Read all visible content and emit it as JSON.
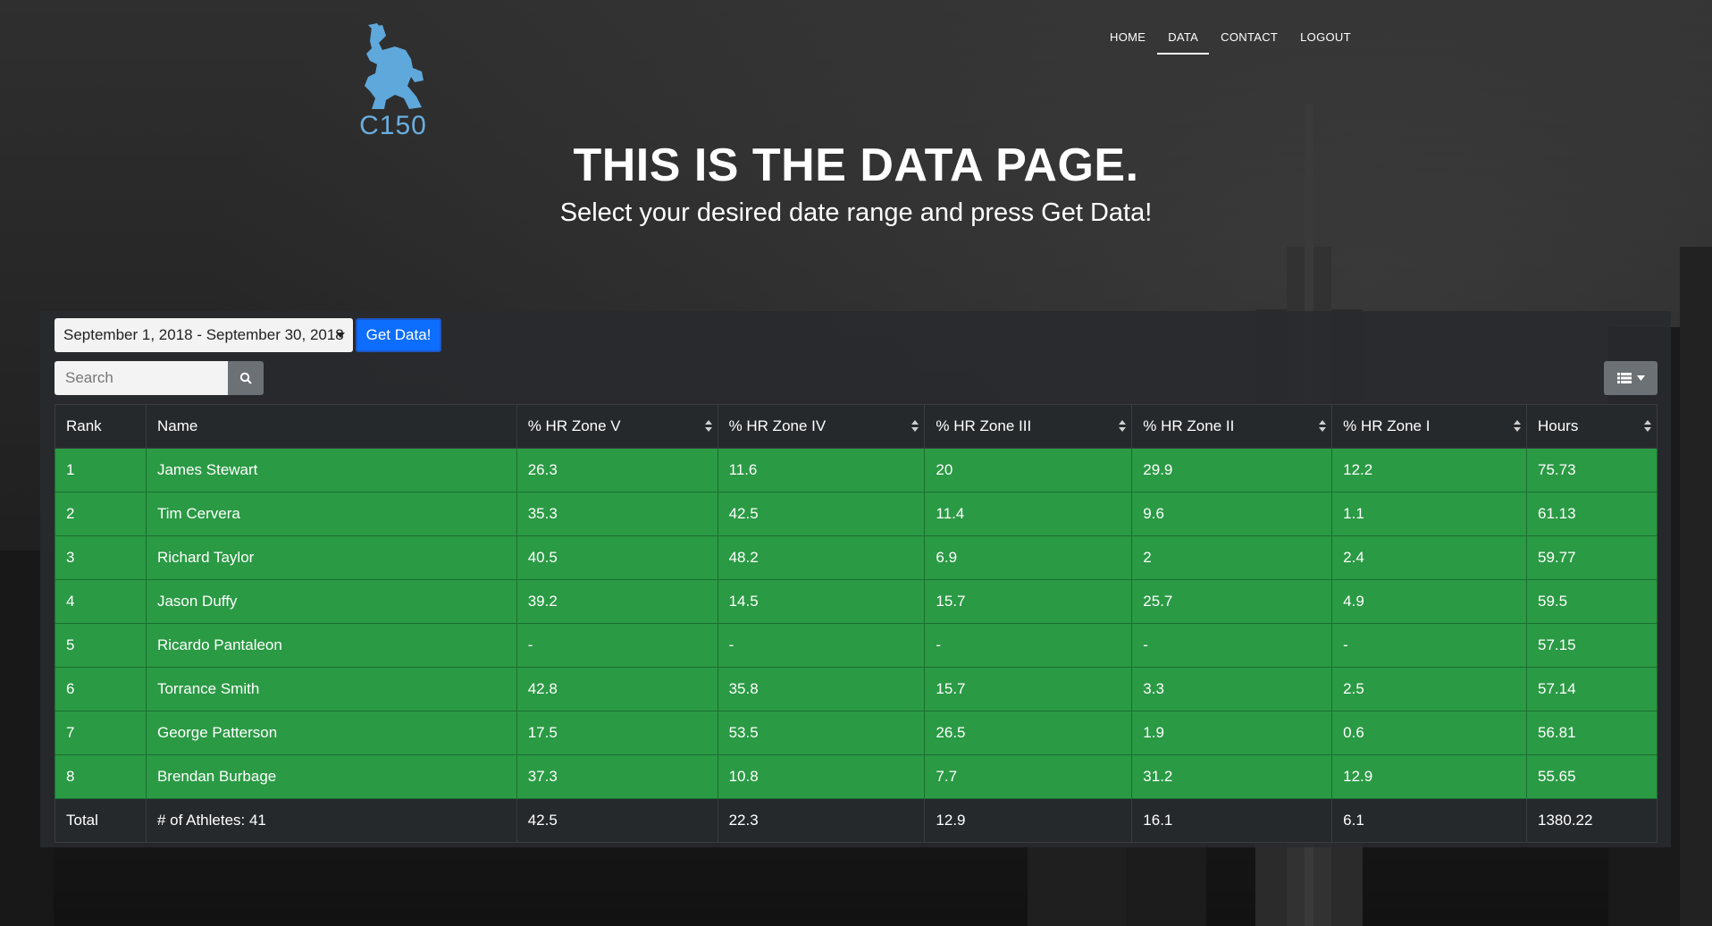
{
  "logo": {
    "text": "C150"
  },
  "nav": {
    "items": [
      "HOME",
      "DATA",
      "CONTACT",
      "LOGOUT"
    ],
    "active": "DATA"
  },
  "hero": {
    "title": "THIS IS THE DATA PAGE.",
    "subtitle": "Select your desired date range and press Get Data!"
  },
  "controls": {
    "date_range": "September 1, 2018 - September 30, 2018",
    "get_data_label": "Get Data!",
    "search_placeholder": "Search"
  },
  "colors": {
    "row_highlight": "#2a9a44",
    "primary_button": "#0d6efd",
    "logo_blue": "#6aaee0"
  },
  "table": {
    "headers": [
      "Rank",
      "Name",
      "% HR Zone V",
      "% HR Zone IV",
      "% HR Zone III",
      "% HR Zone II",
      "% HR Zone I",
      "Hours"
    ],
    "rows": [
      [
        "1",
        "James Stewart",
        "26.3",
        "11.6",
        "20",
        "29.9",
        "12.2",
        "75.73"
      ],
      [
        "2",
        "Tim Cervera",
        "35.3",
        "42.5",
        "11.4",
        "9.6",
        "1.1",
        "61.13"
      ],
      [
        "3",
        "Richard Taylor",
        "40.5",
        "48.2",
        "6.9",
        "2",
        "2.4",
        "59.77"
      ],
      [
        "4",
        "Jason Duffy",
        "39.2",
        "14.5",
        "15.7",
        "25.7",
        "4.9",
        "59.5"
      ],
      [
        "5",
        "Ricardo Pantaleon",
        "-",
        "-",
        "-",
        "-",
        "-",
        "57.15"
      ],
      [
        "6",
        "Torrance Smith",
        "42.8",
        "35.8",
        "15.7",
        "3.3",
        "2.5",
        "57.14"
      ],
      [
        "7",
        "George Patterson",
        "17.5",
        "53.5",
        "26.5",
        "1.9",
        "0.6",
        "56.81"
      ],
      [
        "8",
        "Brendan Burbage",
        "37.3",
        "10.8",
        "7.7",
        "31.2",
        "12.9",
        "55.65"
      ]
    ],
    "footer": [
      "Total",
      "# of Athletes: 41",
      "42.5",
      "22.3",
      "12.9",
      "16.1",
      "6.1",
      "1380.22"
    ]
  }
}
